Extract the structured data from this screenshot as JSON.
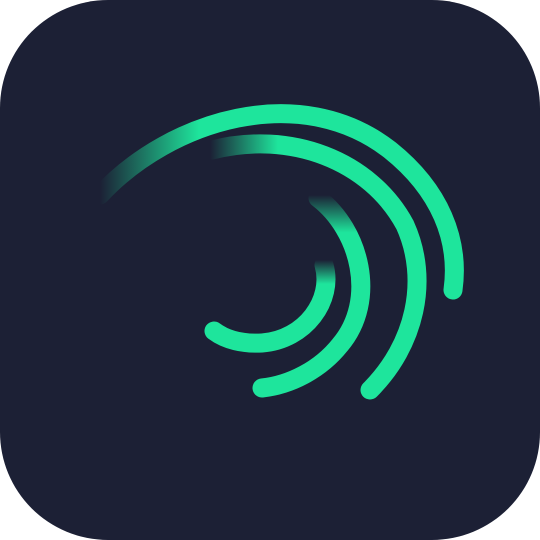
{
  "icon": {
    "name": "alight-motion-app-icon",
    "background_color": "#1c2035",
    "accent_color": "#1ee59c",
    "glyph": "swirl-arcs-logo"
  }
}
